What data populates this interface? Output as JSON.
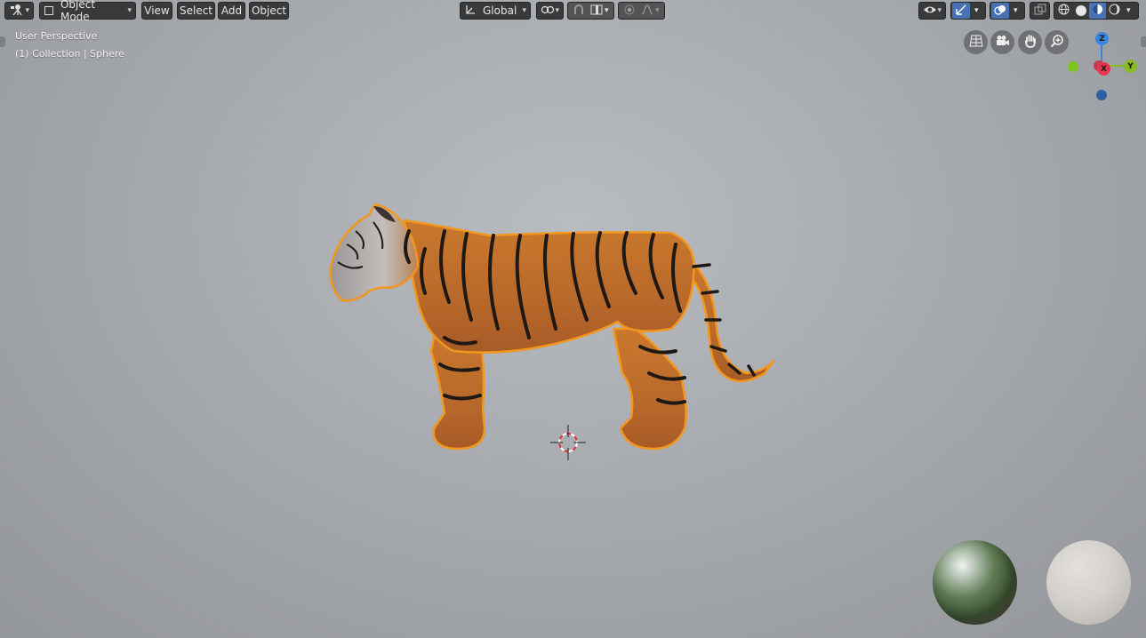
{
  "header": {
    "editor_type_icon": "camera-tripod-icon",
    "mode": "Object Mode",
    "menus": [
      "View",
      "Select",
      "Add",
      "Object"
    ],
    "transform_orientation": "Global",
    "icons": {
      "pivot": "pivot-link-icon",
      "snap": "snap-magnet-icon",
      "snap_target": "snap-increment-icon",
      "proportional": "proportional-edit-icon",
      "falloff": "falloff-curve-icon",
      "visibility": "eye-selectability-icon",
      "gizmo": "gizmo-icon",
      "overlays": "overlays-icon",
      "xray": "xray-icon",
      "shading_wire": "wireframe-shading-icon",
      "shading_solid": "solid-shading-icon",
      "shading_material": "material-preview-shading-icon",
      "shading_rendered": "rendered-shading-icon"
    },
    "active_shading": "material"
  },
  "viewport": {
    "view_name": "User Perspective",
    "collection_info": "(1) Collection | Sphere",
    "object": "tiger",
    "selection_outline_color": "#f5a623"
  },
  "navigation": {
    "buttons": [
      "grid-view-icon",
      "camera-icon",
      "hand-pan-icon",
      "zoom-icon"
    ],
    "axes": {
      "z": "Z",
      "x": "X",
      "y": "Y"
    },
    "axis_colors": {
      "x": "#e8364f",
      "y": "#8aba27",
      "z": "#3b83dc"
    }
  },
  "hdri_preview": {
    "left": "hdri-sphere",
    "right": "matte-sphere"
  }
}
